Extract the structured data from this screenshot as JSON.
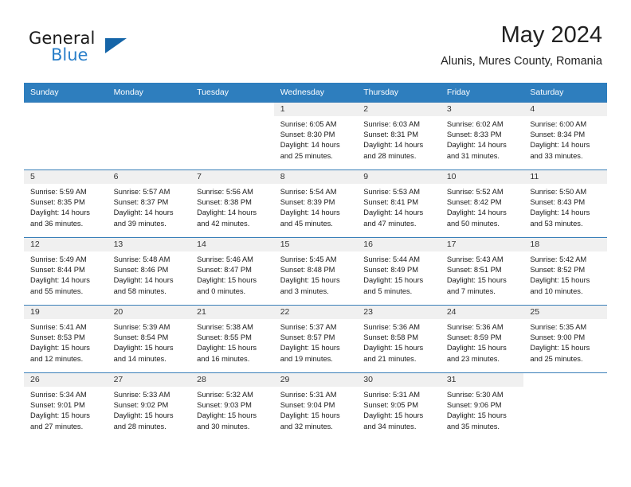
{
  "logo": {
    "word1": "General",
    "word2": "Blue",
    "triangle_color": "#1565a8",
    "blue_color": "#2a7fc9"
  },
  "header": {
    "month_title": "May 2024",
    "location": "Alunis, Mures County, Romania"
  },
  "theme": {
    "header_bg": "#2e7ebe",
    "date_band_bg": "#f0f0f0",
    "row_border": "#3a7fb8"
  },
  "weekday_headers": [
    "Sunday",
    "Monday",
    "Tuesday",
    "Wednesday",
    "Thursday",
    "Friday",
    "Saturday"
  ],
  "weeks": [
    [
      {
        "empty": true
      },
      {
        "empty": true
      },
      {
        "empty": true
      },
      {
        "date": "1",
        "sunrise": "Sunrise: 6:05 AM",
        "sunset": "Sunset: 8:30 PM",
        "daylight1": "Daylight: 14 hours",
        "daylight2": "and 25 minutes."
      },
      {
        "date": "2",
        "sunrise": "Sunrise: 6:03 AM",
        "sunset": "Sunset: 8:31 PM",
        "daylight1": "Daylight: 14 hours",
        "daylight2": "and 28 minutes."
      },
      {
        "date": "3",
        "sunrise": "Sunrise: 6:02 AM",
        "sunset": "Sunset: 8:33 PM",
        "daylight1": "Daylight: 14 hours",
        "daylight2": "and 31 minutes."
      },
      {
        "date": "4",
        "sunrise": "Sunrise: 6:00 AM",
        "sunset": "Sunset: 8:34 PM",
        "daylight1": "Daylight: 14 hours",
        "daylight2": "and 33 minutes."
      }
    ],
    [
      {
        "date": "5",
        "sunrise": "Sunrise: 5:59 AM",
        "sunset": "Sunset: 8:35 PM",
        "daylight1": "Daylight: 14 hours",
        "daylight2": "and 36 minutes."
      },
      {
        "date": "6",
        "sunrise": "Sunrise: 5:57 AM",
        "sunset": "Sunset: 8:37 PM",
        "daylight1": "Daylight: 14 hours",
        "daylight2": "and 39 minutes."
      },
      {
        "date": "7",
        "sunrise": "Sunrise: 5:56 AM",
        "sunset": "Sunset: 8:38 PM",
        "daylight1": "Daylight: 14 hours",
        "daylight2": "and 42 minutes."
      },
      {
        "date": "8",
        "sunrise": "Sunrise: 5:54 AM",
        "sunset": "Sunset: 8:39 PM",
        "daylight1": "Daylight: 14 hours",
        "daylight2": "and 45 minutes."
      },
      {
        "date": "9",
        "sunrise": "Sunrise: 5:53 AM",
        "sunset": "Sunset: 8:41 PM",
        "daylight1": "Daylight: 14 hours",
        "daylight2": "and 47 minutes."
      },
      {
        "date": "10",
        "sunrise": "Sunrise: 5:52 AM",
        "sunset": "Sunset: 8:42 PM",
        "daylight1": "Daylight: 14 hours",
        "daylight2": "and 50 minutes."
      },
      {
        "date": "11",
        "sunrise": "Sunrise: 5:50 AM",
        "sunset": "Sunset: 8:43 PM",
        "daylight1": "Daylight: 14 hours",
        "daylight2": "and 53 minutes."
      }
    ],
    [
      {
        "date": "12",
        "sunrise": "Sunrise: 5:49 AM",
        "sunset": "Sunset: 8:44 PM",
        "daylight1": "Daylight: 14 hours",
        "daylight2": "and 55 minutes."
      },
      {
        "date": "13",
        "sunrise": "Sunrise: 5:48 AM",
        "sunset": "Sunset: 8:46 PM",
        "daylight1": "Daylight: 14 hours",
        "daylight2": "and 58 minutes."
      },
      {
        "date": "14",
        "sunrise": "Sunrise: 5:46 AM",
        "sunset": "Sunset: 8:47 PM",
        "daylight1": "Daylight: 15 hours",
        "daylight2": "and 0 minutes."
      },
      {
        "date": "15",
        "sunrise": "Sunrise: 5:45 AM",
        "sunset": "Sunset: 8:48 PM",
        "daylight1": "Daylight: 15 hours",
        "daylight2": "and 3 minutes."
      },
      {
        "date": "16",
        "sunrise": "Sunrise: 5:44 AM",
        "sunset": "Sunset: 8:49 PM",
        "daylight1": "Daylight: 15 hours",
        "daylight2": "and 5 minutes."
      },
      {
        "date": "17",
        "sunrise": "Sunrise: 5:43 AM",
        "sunset": "Sunset: 8:51 PM",
        "daylight1": "Daylight: 15 hours",
        "daylight2": "and 7 minutes."
      },
      {
        "date": "18",
        "sunrise": "Sunrise: 5:42 AM",
        "sunset": "Sunset: 8:52 PM",
        "daylight1": "Daylight: 15 hours",
        "daylight2": "and 10 minutes."
      }
    ],
    [
      {
        "date": "19",
        "sunrise": "Sunrise: 5:41 AM",
        "sunset": "Sunset: 8:53 PM",
        "daylight1": "Daylight: 15 hours",
        "daylight2": "and 12 minutes."
      },
      {
        "date": "20",
        "sunrise": "Sunrise: 5:39 AM",
        "sunset": "Sunset: 8:54 PM",
        "daylight1": "Daylight: 15 hours",
        "daylight2": "and 14 minutes."
      },
      {
        "date": "21",
        "sunrise": "Sunrise: 5:38 AM",
        "sunset": "Sunset: 8:55 PM",
        "daylight1": "Daylight: 15 hours",
        "daylight2": "and 16 minutes."
      },
      {
        "date": "22",
        "sunrise": "Sunrise: 5:37 AM",
        "sunset": "Sunset: 8:57 PM",
        "daylight1": "Daylight: 15 hours",
        "daylight2": "and 19 minutes."
      },
      {
        "date": "23",
        "sunrise": "Sunrise: 5:36 AM",
        "sunset": "Sunset: 8:58 PM",
        "daylight1": "Daylight: 15 hours",
        "daylight2": "and 21 minutes."
      },
      {
        "date": "24",
        "sunrise": "Sunrise: 5:36 AM",
        "sunset": "Sunset: 8:59 PM",
        "daylight1": "Daylight: 15 hours",
        "daylight2": "and 23 minutes."
      },
      {
        "date": "25",
        "sunrise": "Sunrise: 5:35 AM",
        "sunset": "Sunset: 9:00 PM",
        "daylight1": "Daylight: 15 hours",
        "daylight2": "and 25 minutes."
      }
    ],
    [
      {
        "date": "26",
        "sunrise": "Sunrise: 5:34 AM",
        "sunset": "Sunset: 9:01 PM",
        "daylight1": "Daylight: 15 hours",
        "daylight2": "and 27 minutes."
      },
      {
        "date": "27",
        "sunrise": "Sunrise: 5:33 AM",
        "sunset": "Sunset: 9:02 PM",
        "daylight1": "Daylight: 15 hours",
        "daylight2": "and 28 minutes."
      },
      {
        "date": "28",
        "sunrise": "Sunrise: 5:32 AM",
        "sunset": "Sunset: 9:03 PM",
        "daylight1": "Daylight: 15 hours",
        "daylight2": "and 30 minutes."
      },
      {
        "date": "29",
        "sunrise": "Sunrise: 5:31 AM",
        "sunset": "Sunset: 9:04 PM",
        "daylight1": "Daylight: 15 hours",
        "daylight2": "and 32 minutes."
      },
      {
        "date": "30",
        "sunrise": "Sunrise: 5:31 AM",
        "sunset": "Sunset: 9:05 PM",
        "daylight1": "Daylight: 15 hours",
        "daylight2": "and 34 minutes."
      },
      {
        "date": "31",
        "sunrise": "Sunrise: 5:30 AM",
        "sunset": "Sunset: 9:06 PM",
        "daylight1": "Daylight: 15 hours",
        "daylight2": "and 35 minutes."
      },
      {
        "empty": true
      }
    ]
  ]
}
